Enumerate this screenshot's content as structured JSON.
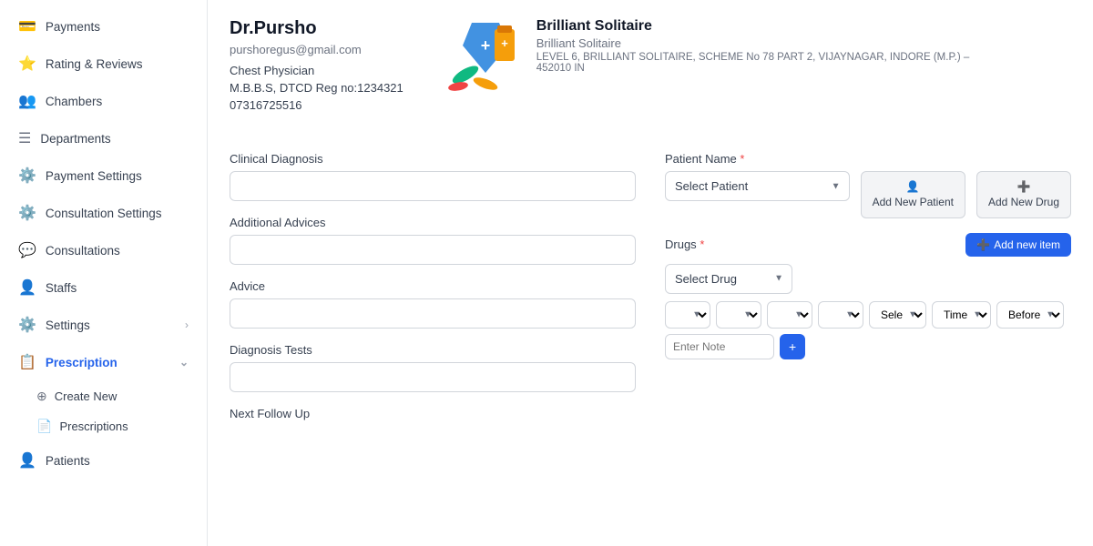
{
  "sidebar": {
    "items": [
      {
        "id": "payments",
        "label": "Payments",
        "icon": "💳",
        "active": false
      },
      {
        "id": "rating-reviews",
        "label": "Rating & Reviews",
        "icon": "⭐",
        "active": false
      },
      {
        "id": "chambers",
        "label": "Chambers",
        "icon": "👥",
        "active": false
      },
      {
        "id": "departments",
        "label": "Departments",
        "icon": "☰",
        "active": false
      },
      {
        "id": "payment-settings",
        "label": "Payment Settings",
        "icon": "⚙️",
        "active": false
      },
      {
        "id": "consultation-settings",
        "label": "Consultation Settings",
        "icon": "⚙️",
        "active": false
      },
      {
        "id": "consultations",
        "label": "Consultations",
        "icon": "💬",
        "active": false
      },
      {
        "id": "staffs",
        "label": "Staffs",
        "icon": "👤",
        "active": false
      },
      {
        "id": "settings",
        "label": "Settings",
        "icon": "⚙️",
        "active": false,
        "hasChevron": true
      },
      {
        "id": "prescription",
        "label": "Prescription",
        "icon": "📋",
        "active": true,
        "hasChevron": true
      }
    ],
    "sub_items": [
      {
        "id": "create-new",
        "label": "Create New",
        "icon": "➕"
      },
      {
        "id": "prescriptions",
        "label": "Prescriptions",
        "icon": "📄"
      }
    ],
    "patients": {
      "id": "patients",
      "label": "Patients",
      "icon": "👤"
    }
  },
  "doctor": {
    "name": "Dr.Pursho",
    "email": "purshoregus@gmail.com",
    "specialty": "Chest Physician",
    "reg": "M.B.B.S, DTCD Reg no:1234321",
    "phone": "07316725516"
  },
  "clinic": {
    "name": "Brilliant Solitaire",
    "sub": "Brilliant Solitaire",
    "address": "LEVEL 6, BRILLIANT SOLITAIRE, SCHEME No 78 PART 2, VIJAYNAGAR, INDORE (M.P.) – 452010 IN"
  },
  "form": {
    "clinical_diagnosis_label": "Clinical Diagnosis",
    "clinical_diagnosis_placeholder": "",
    "patient_name_label": "Patient Name",
    "patient_name_required": "*",
    "patient_select_placeholder": "Select Patient",
    "additional_advices_label": "Additional Advices",
    "advice_label": "Advice",
    "diagnosis_tests_label": "Diagnosis Tests",
    "next_follow_up_label": "Next Follow Up",
    "drugs_label": "Drugs",
    "drugs_required": "*",
    "drug_select_placeholder": "Select Drug",
    "add_new_patient_label": "Add New Patient",
    "add_new_drug_label": "Add New Drug",
    "add_new_item_label": "Add new item",
    "add_new_patient_icon": "👤",
    "add_new_drug_icon": "➕",
    "add_new_item_icon": "➕",
    "dropdowns": [
      "",
      "",
      "",
      ""
    ],
    "right_dropdowns": [
      "Sele",
      "Time",
      "Before"
    ],
    "note_placeholder": "Enter Note"
  }
}
